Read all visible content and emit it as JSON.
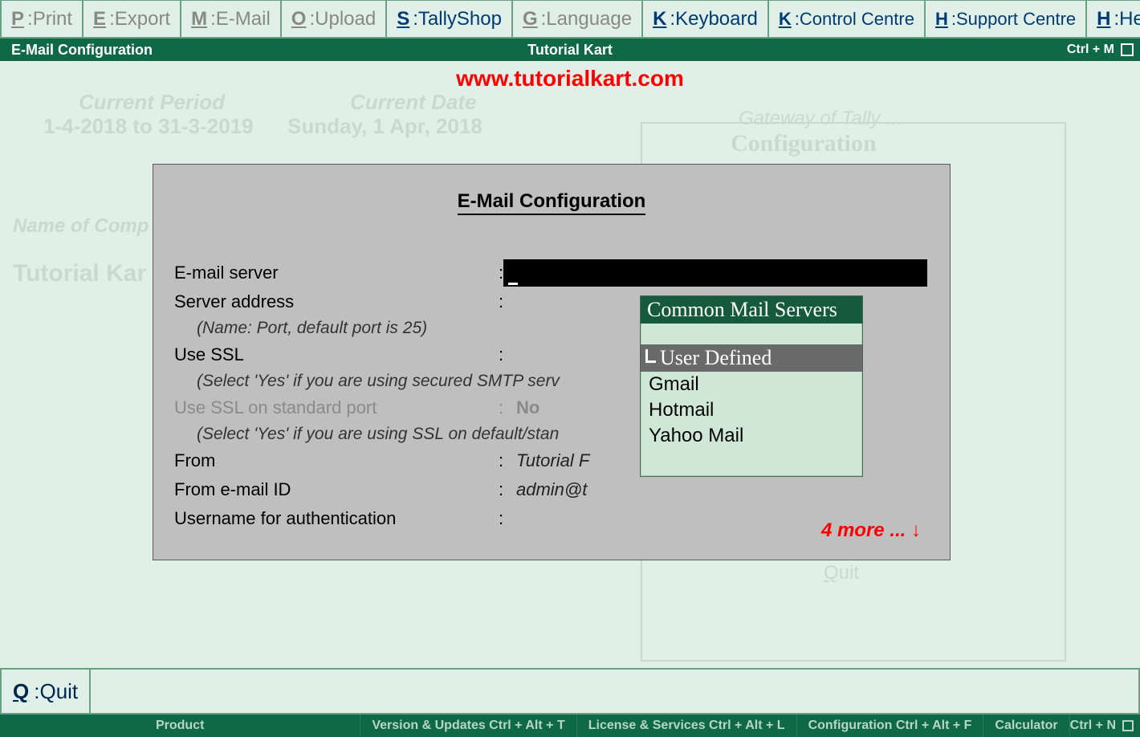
{
  "top_menu": [
    {
      "key": "P",
      "label": "Print",
      "active": false
    },
    {
      "key": "E",
      "label": "Export",
      "active": false
    },
    {
      "key": "M",
      "label": "E-Mail",
      "active": false
    },
    {
      "key": "O",
      "label": "Upload",
      "active": false
    },
    {
      "key": "S",
      "label": "TallyShop",
      "active": true
    },
    {
      "key": "G",
      "label": "Language",
      "active": false
    },
    {
      "key": "K",
      "label": "Keyboard",
      "active": true
    },
    {
      "key": "K",
      "label": "Control Centre",
      "active": true,
      "smaller": true
    },
    {
      "key": "H",
      "label": "Support Centre",
      "active": true,
      "smaller": true
    },
    {
      "key": "H",
      "label": "Help",
      "active": true
    }
  ],
  "sub_bar": {
    "left": "E-Mail Configuration",
    "center": "Tutorial Kart",
    "right_shortcut": "Ctrl + M"
  },
  "overlay_url": "www.tutorialkart.com",
  "background": {
    "current_period_label": "Current Period",
    "current_period_value": "1-4-2018 to 31-3-2019",
    "current_date_label": "Current Date",
    "current_date_value": "Sunday, 1 Apr, 2018",
    "name_of_comp": "Name of Comp",
    "company": "Tutorial Kar",
    "gateway_title": "Gateway of Tally ....",
    "gateway_sub": "Configuration",
    "gateway_quit_key": "Q",
    "gateway_quit_label": "uit"
  },
  "modal": {
    "title": "E-Mail Configuration",
    "rows": {
      "email_server": "E-mail server",
      "server_address": "Server address",
      "server_hint": "(Name: Port, default port is 25)",
      "use_ssl": "Use SSL",
      "use_ssl_hint": "(Select 'Yes' if you are using secured SMTP serv",
      "use_ssl_std": "Use SSL on standard port",
      "use_ssl_std_val": "No",
      "use_ssl_std_hint": "(Select 'Yes' if you are using SSL on default/stan",
      "from": "From",
      "from_val": "Tutorial F",
      "from_email": "From e-mail ID",
      "from_email_val": "admin@t",
      "username": "Username for authentication"
    },
    "more": "4 more ... ↓"
  },
  "dropdown": {
    "title": "Common Mail Servers",
    "items": [
      {
        "label": "User Defined",
        "selected": true
      },
      {
        "label": "Gmail",
        "selected": false
      },
      {
        "label": "Hotmail",
        "selected": false
      },
      {
        "label": "Yahoo Mail",
        "selected": false
      }
    ]
  },
  "quit_bar": {
    "key": "Q",
    "label": "Quit"
  },
  "status": {
    "product": "Product",
    "version": "Version & Updates Ctrl + Alt + T",
    "license": "License & Services Ctrl + Alt + L",
    "config": "Configuration   Ctrl + Alt + F",
    "calc": "Calculator",
    "calc_short": "Ctrl + N"
  }
}
